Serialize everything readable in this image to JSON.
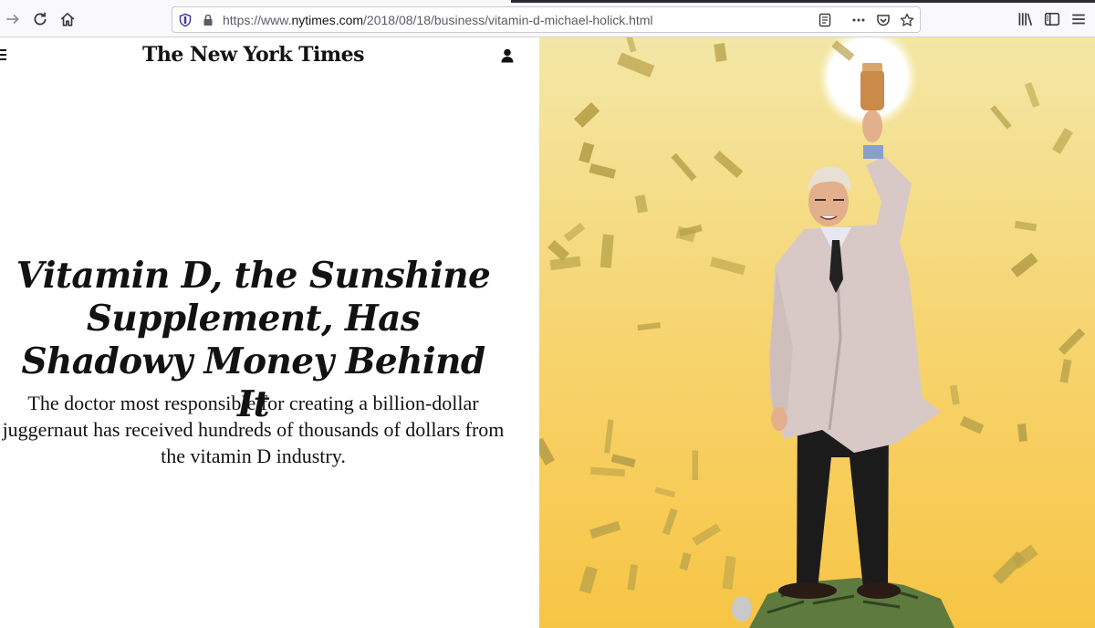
{
  "browser": {
    "url_prefix": "https://www.",
    "url_host": "nytimes.com",
    "url_path": "/2018/08/18/business/vitamin-d-michael-holick.html",
    "icons": {
      "forward": "forward-arrow-icon",
      "reload": "reload-icon",
      "home": "home-icon",
      "tracking": "tracking-protection-shield-icon",
      "lock": "lock-icon",
      "reader": "reader-view-icon",
      "more": "page-actions-more-icon",
      "pocket": "pocket-icon",
      "bookmark": "bookmark-star-icon",
      "library": "library-icon",
      "sidebar": "sidebar-icon",
      "menu": "app-menu-icon"
    }
  },
  "page": {
    "masthead": "The New York Times",
    "headline": "Vitamin D, the Sunshine Supplement, Has Shadowy Money Behind It",
    "summary": "The doctor most responsible for creating a billion-dollar juggernaut has received hundreds of thousands of dollars from the vitamin D industry.",
    "icons": {
      "menu": "hamburger-menu-icon",
      "account": "user-account-icon"
    },
    "illustration": "illustration of doctor holding up vitamin bottle amid falling money",
    "colors": {
      "sky_top": "#f3e7a6",
      "sky_bottom": "#f7c545",
      "money": "#b8a24a",
      "text": "#121212"
    }
  }
}
